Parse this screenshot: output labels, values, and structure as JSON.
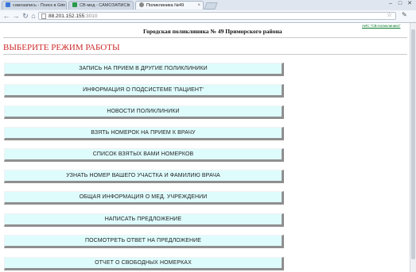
{
  "browser": {
    "tabs": [
      {
        "label": "самозапись - Поиск в Goo",
        "fav_color": "#3a76d8"
      },
      {
        "label": "СВ-мед - САМОЗАПИСЬ",
        "fav_color": "#2a9a4a"
      },
      {
        "label": "Поликлиника №49",
        "fav_color": "#888888"
      }
    ],
    "url_host": "88.201.152.155",
    "url_port": ":3010"
  },
  "page": {
    "clinic_title": "Городская поликлиника № 49 Приморского района",
    "aic_link": "АИС \"СВ-поликлиника\"",
    "mode_title": "ВЫБЕРИТЕ РЕЖИМ РАБОТЫ",
    "menu": [
      "ЗАПИСЬ НА ПРИЕМ В ДРУГИЕ ПОЛИКЛИНИКИ",
      "ИНФОРМАЦИЯ О ПОДСИСТЕМЕ 'ПАЦИЕНТ'",
      "НОВОСТИ ПОЛИКЛИНИКИ",
      "ВЗЯТЬ НОМЕРОК НА ПРИЕМ К ВРАЧУ",
      "СПИСОК ВЗЯТЫХ ВАМИ НОМЕРКОВ",
      "УЗНАТЬ НОМЕР ВАШЕГО УЧАСТКА И ФАМИЛИЮ ВРАЧА",
      "ОБЩАЯ ИНФОРМАЦИЯ О МЕД. УЧРЕЖДЕНИИ",
      "НАПИСАТЬ ПРЕДЛОЖЕНИЕ",
      "ПОСМОТРЕТЬ ОТВЕТ НА ПРЕДЛОЖЕНИЕ",
      "ОТЧЕТ О СВОБОДНЫХ НОМЕРКАХ"
    ]
  }
}
